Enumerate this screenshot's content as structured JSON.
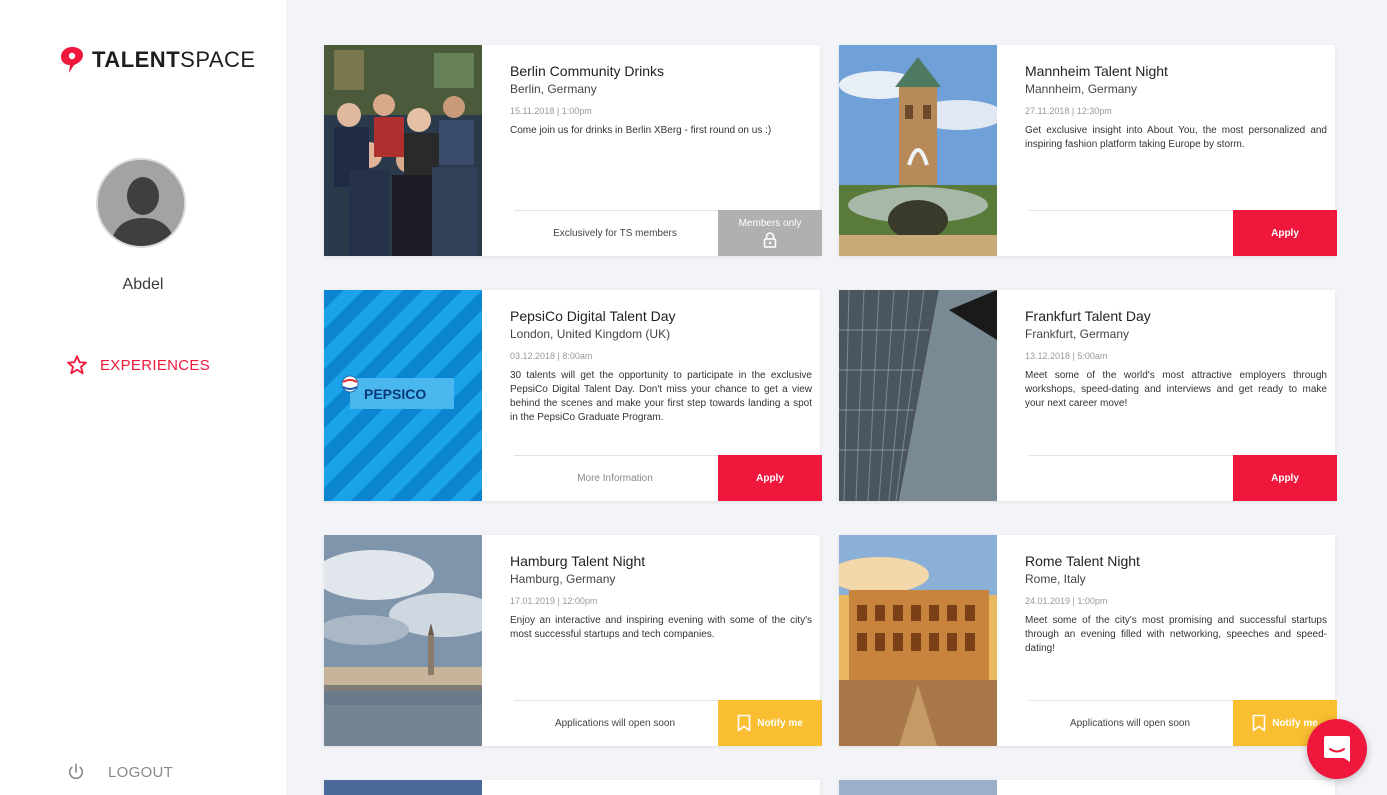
{
  "brand": {
    "name_bold": "TALENT",
    "name_light": "SPACE",
    "accent": "#f0173c"
  },
  "user": {
    "name": "Abdel"
  },
  "nav": {
    "experiences": "EXPERIENCES",
    "logout": "LOGOUT"
  },
  "cards": [
    {
      "title": "Berlin Community Drinks",
      "location": "Berlin, Germany",
      "date": "15.11.2018 | 1:00pm",
      "description": "Come join us for drinks in Berlin XBerg - first round on us :)",
      "footer_text": "Exclusively for TS members",
      "button": "Members only",
      "button_type": "members",
      "image": "crowd-photo"
    },
    {
      "title": "Mannheim Talent Night",
      "location": "Mannheim, Germany",
      "date": "27.11.2018 | 12:30pm",
      "description": "Get exclusive insight into About You, the most personalized and inspiring fashion platform taking Europe by storm.",
      "footer_text": "",
      "button": "Apply",
      "button_type": "apply",
      "image": "water-tower-photo"
    },
    {
      "title": "PepsiCo Digital Talent Day",
      "location": "London, United Kingdom (UK)",
      "date": "03.12.2018 | 8:00am",
      "description": "30 talents will get the opportunity to participate in the exclusive PepsiCo Digital Talent Day. Don't miss your chance to  get a view behind the scenes and make your first step towards landing a spot in the PepsiCo Graduate Program.",
      "footer_text": "More Information",
      "button": "Apply",
      "button_type": "apply",
      "image": "pepsico-logo",
      "logo_text": "PEPSICO"
    },
    {
      "title": "Frankfurt Talent Day",
      "location": "Frankfurt, Germany",
      "date": "13.12.2018 | 5:00am",
      "description": "Meet some of the world's most attractive employers through workshops, speed-dating and interviews and get ready to make your next career move!",
      "footer_text": "",
      "button": "Apply",
      "button_type": "apply",
      "image": "skyscraper-photo"
    },
    {
      "title": "Hamburg Talent Night",
      "location": "Hamburg, Germany",
      "date": "17.01.2019 | 12:00pm",
      "description": "Enjoy an interactive and inspiring evening with some of the city's most successful startups and tech companies.",
      "footer_text": "Applications will open soon",
      "button": "Notify me",
      "button_type": "notify",
      "image": "hamburg-skyline-photo"
    },
    {
      "title": "Rome Talent Night",
      "location": "Rome, Italy",
      "date": "24.01.2019 | 1:00pm",
      "description": "Meet some of the city's most promising and successful startups through an evening filled with networking, speeches and speed-dating!",
      "footer_text": "Applications will open soon",
      "button": "Notify me",
      "button_type": "notify",
      "image": "colosseum-photo"
    }
  ]
}
